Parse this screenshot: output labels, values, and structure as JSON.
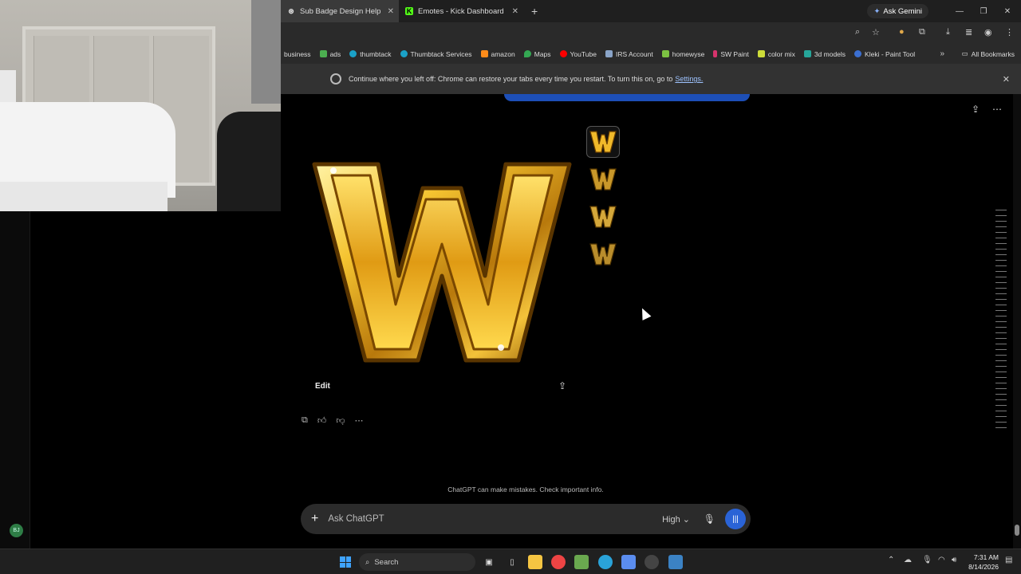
{
  "tabs": [
    {
      "title": "Sub Badge Design Help",
      "active": true
    },
    {
      "title": "Emotes - Kick Dashboard",
      "active": false
    }
  ],
  "ask_gemini": "Ask Gemini",
  "bookmarks": [
    {
      "label": "business",
      "color": ""
    },
    {
      "label": "ads",
      "color": "#4caf50"
    },
    {
      "label": "thumbtack",
      "color": "#1aa1c7"
    },
    {
      "label": "Thumbtack Services",
      "color": "#1aa1c7"
    },
    {
      "label": "amazon",
      "color": "#ff8c1a"
    },
    {
      "label": "Maps",
      "color": "#34a853"
    },
    {
      "label": "YouTube",
      "color": "#ff0000"
    },
    {
      "label": "IRS Account",
      "color": "#8aa4c8"
    },
    {
      "label": "homewyse",
      "color": "#7cc242"
    },
    {
      "label": "SW Paint",
      "color": "#d6336c"
    },
    {
      "label": "color mix",
      "color": "#cddc39"
    },
    {
      "label": "3d models",
      "color": "#26a69a"
    },
    {
      "label": "Kleki - Paint Tool",
      "color": "#3b6fd1"
    }
  ],
  "all_bookmarks": "All Bookmarks",
  "infobar": {
    "message": "Continue where you left off: Chrome can restore your tabs every time you restart. To turn this on, go to",
    "link": "Settings."
  },
  "image_actions": {
    "edit": "Edit"
  },
  "disclaimer": "ChatGPT can make mistakes. Check important info.",
  "composer": {
    "placeholder": "Ask ChatGPT",
    "mode": "High"
  },
  "avatar_initials": "BJ",
  "taskbar": {
    "search": "Search",
    "time": "7:31 AM",
    "date": "8/14/2026"
  },
  "colors": {
    "accent": "#2a63d6",
    "gold": "#f5c431"
  }
}
